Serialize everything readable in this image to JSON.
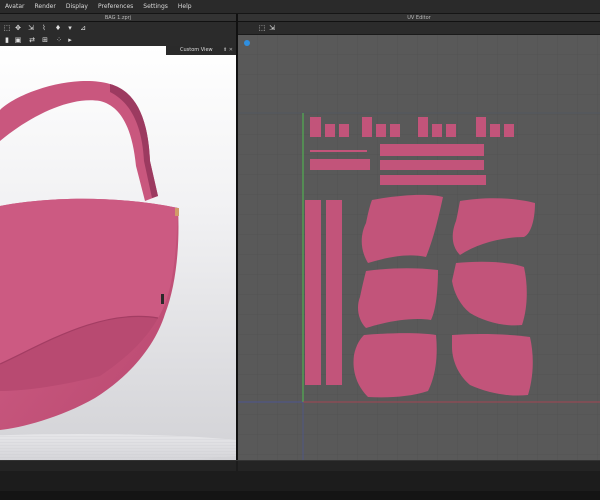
{
  "menu": [
    "Avatar",
    "Render",
    "Display",
    "Preferences",
    "Settings",
    "Help"
  ],
  "left_panel": {
    "title": "BAG 1.zprj",
    "custom_view_label": "Custom View"
  },
  "right_panel": {
    "title": "UV Editor"
  },
  "colors": {
    "fabric": "#c2547a",
    "fabric_dark": "#8e3356",
    "uv_bg": "#595959",
    "grid": "#4d4d4d"
  }
}
